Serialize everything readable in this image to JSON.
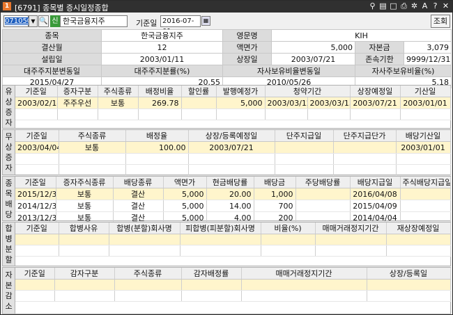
{
  "window": {
    "icon": "1",
    "title": "[6791] 종목별 증시일정종합",
    "controls": [
      "link-icon",
      "memo-icon",
      "window-icon",
      "print-icon",
      "settings-icon",
      "A",
      "?",
      "close-icon"
    ]
  },
  "toolbar": {
    "code": "071050",
    "search_icon": "search-icon",
    "sin_badge": "신",
    "stock_name": "한국금융지주",
    "date_label": "기준일",
    "date": "2016-07-01",
    "query_button": "조회"
  },
  "info": {
    "r1": [
      "종목",
      "한국금융지주",
      "영문명",
      "KIH"
    ],
    "r2": [
      "결산월",
      "12",
      "액면가",
      "5,000",
      "자본금",
      "3,079"
    ],
    "r3": [
      "설립일",
      "2003/01/11",
      "상장일",
      "2003/07/21",
      "존속기한",
      "9999/12/31"
    ],
    "r4": [
      "대주주지분변동일",
      "대주주지분률(%)",
      "자사보유비율변동일",
      "자사주보유비율(%)"
    ],
    "r5": [
      "2015/04/27",
      "20.55",
      "2010/05/26",
      "5.18"
    ]
  },
  "paid": {
    "side": [
      "유",
      "상",
      "증",
      "자"
    ],
    "headers": [
      "기준일",
      "증자구분",
      "주식종류",
      "배정비율",
      "할인률",
      "발행예정가",
      "청약기간",
      "",
      "상장예정일",
      "기산일"
    ],
    "rows": [
      [
        "2003/02/14",
        "주주우선",
        "보통",
        "269.78",
        "",
        "5,000",
        "2003/03/12",
        "2003/03/13",
        "2003/07/21",
        "2003/01/01"
      ]
    ]
  },
  "free": {
    "side": [
      "무",
      "상",
      "증",
      "자"
    ],
    "headers": [
      "기준일",
      "주식종류",
      "배정율",
      "상장/등록예정일",
      "단주지급일",
      "단주지급단가",
      "배당기산일"
    ],
    "rows": [
      [
        "2003/04/04",
        "보통",
        "100.00",
        "2003/07/21",
        "",
        "",
        "2003/01/01"
      ]
    ]
  },
  "div": {
    "side": [
      "종",
      "목",
      "배",
      "당"
    ],
    "headers": [
      "기준일",
      "증자주식종류",
      "배당종류",
      "액면가",
      "현금배당률",
      "배당금",
      "주당배당률",
      "배당지급일",
      "주식배당지급일"
    ],
    "rows": [
      [
        "2015/12/31",
        "보통",
        "결산",
        "5,000",
        "20.00",
        "1,000",
        "",
        "2016/04/08",
        ""
      ],
      [
        "2014/12/31",
        "보통",
        "결산",
        "5,000",
        "14.00",
        "700",
        "",
        "2015/04/09",
        ""
      ],
      [
        "2013/12/31",
        "보통",
        "결산",
        "5,000",
        "4.00",
        "200",
        "",
        "2014/04/04",
        ""
      ]
    ]
  },
  "merge": {
    "side": [
      "합",
      "병",
      "분",
      "할"
    ],
    "headers": [
      "기준일",
      "합병사유",
      "합병(분할)회사명",
      "피합병(피분할)회사명",
      "비율(%)",
      "매매거래정지기간",
      "재상장예정일"
    ]
  },
  "reduce": {
    "side": [
      "자",
      "본",
      "감",
      "소"
    ],
    "headers": [
      "기준일",
      "감자구분",
      "주식종류",
      "감자배정률",
      "매매거래정지기간",
      "상장/등록일"
    ]
  }
}
